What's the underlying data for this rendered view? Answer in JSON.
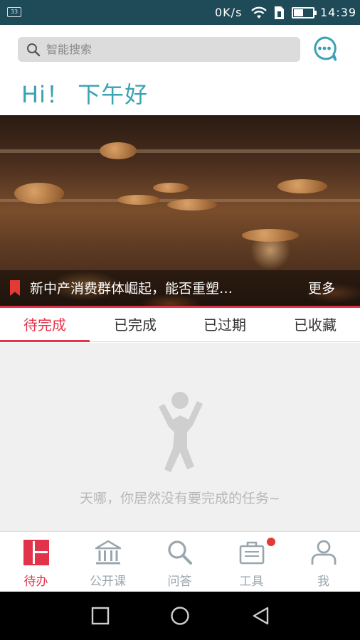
{
  "status_bar": {
    "notification": "33",
    "speed": "0K/s",
    "time": "14:39",
    "battery_level": 0.45
  },
  "search": {
    "placeholder": "智能搜索"
  },
  "greeting": "Hi！ 下午好",
  "banner": {
    "headline": "新中产消费群体崛起，能否重塑…",
    "more_label": "更多"
  },
  "tabs": [
    {
      "label": "待完成",
      "active": true
    },
    {
      "label": "已完成",
      "active": false
    },
    {
      "label": "已过期",
      "active": false
    },
    {
      "label": "已收藏",
      "active": false
    }
  ],
  "empty_state": {
    "message": "天哪，你居然没有要完成的任务~"
  },
  "bottom_nav": [
    {
      "label": "待办",
      "icon": "todo-grid-icon",
      "active": true
    },
    {
      "label": "公开课",
      "icon": "bank-building-icon",
      "active": false
    },
    {
      "label": "问答",
      "icon": "search-icon",
      "active": false
    },
    {
      "label": "工具",
      "icon": "toolbox-icon",
      "active": false,
      "badge": true
    },
    {
      "label": "我",
      "icon": "person-icon",
      "active": false
    }
  ],
  "colors": {
    "accent": "#e2334a",
    "greeting": "#3aa2b3",
    "status_bar": "#1f4a57",
    "inactive": "#9aa6ad"
  }
}
